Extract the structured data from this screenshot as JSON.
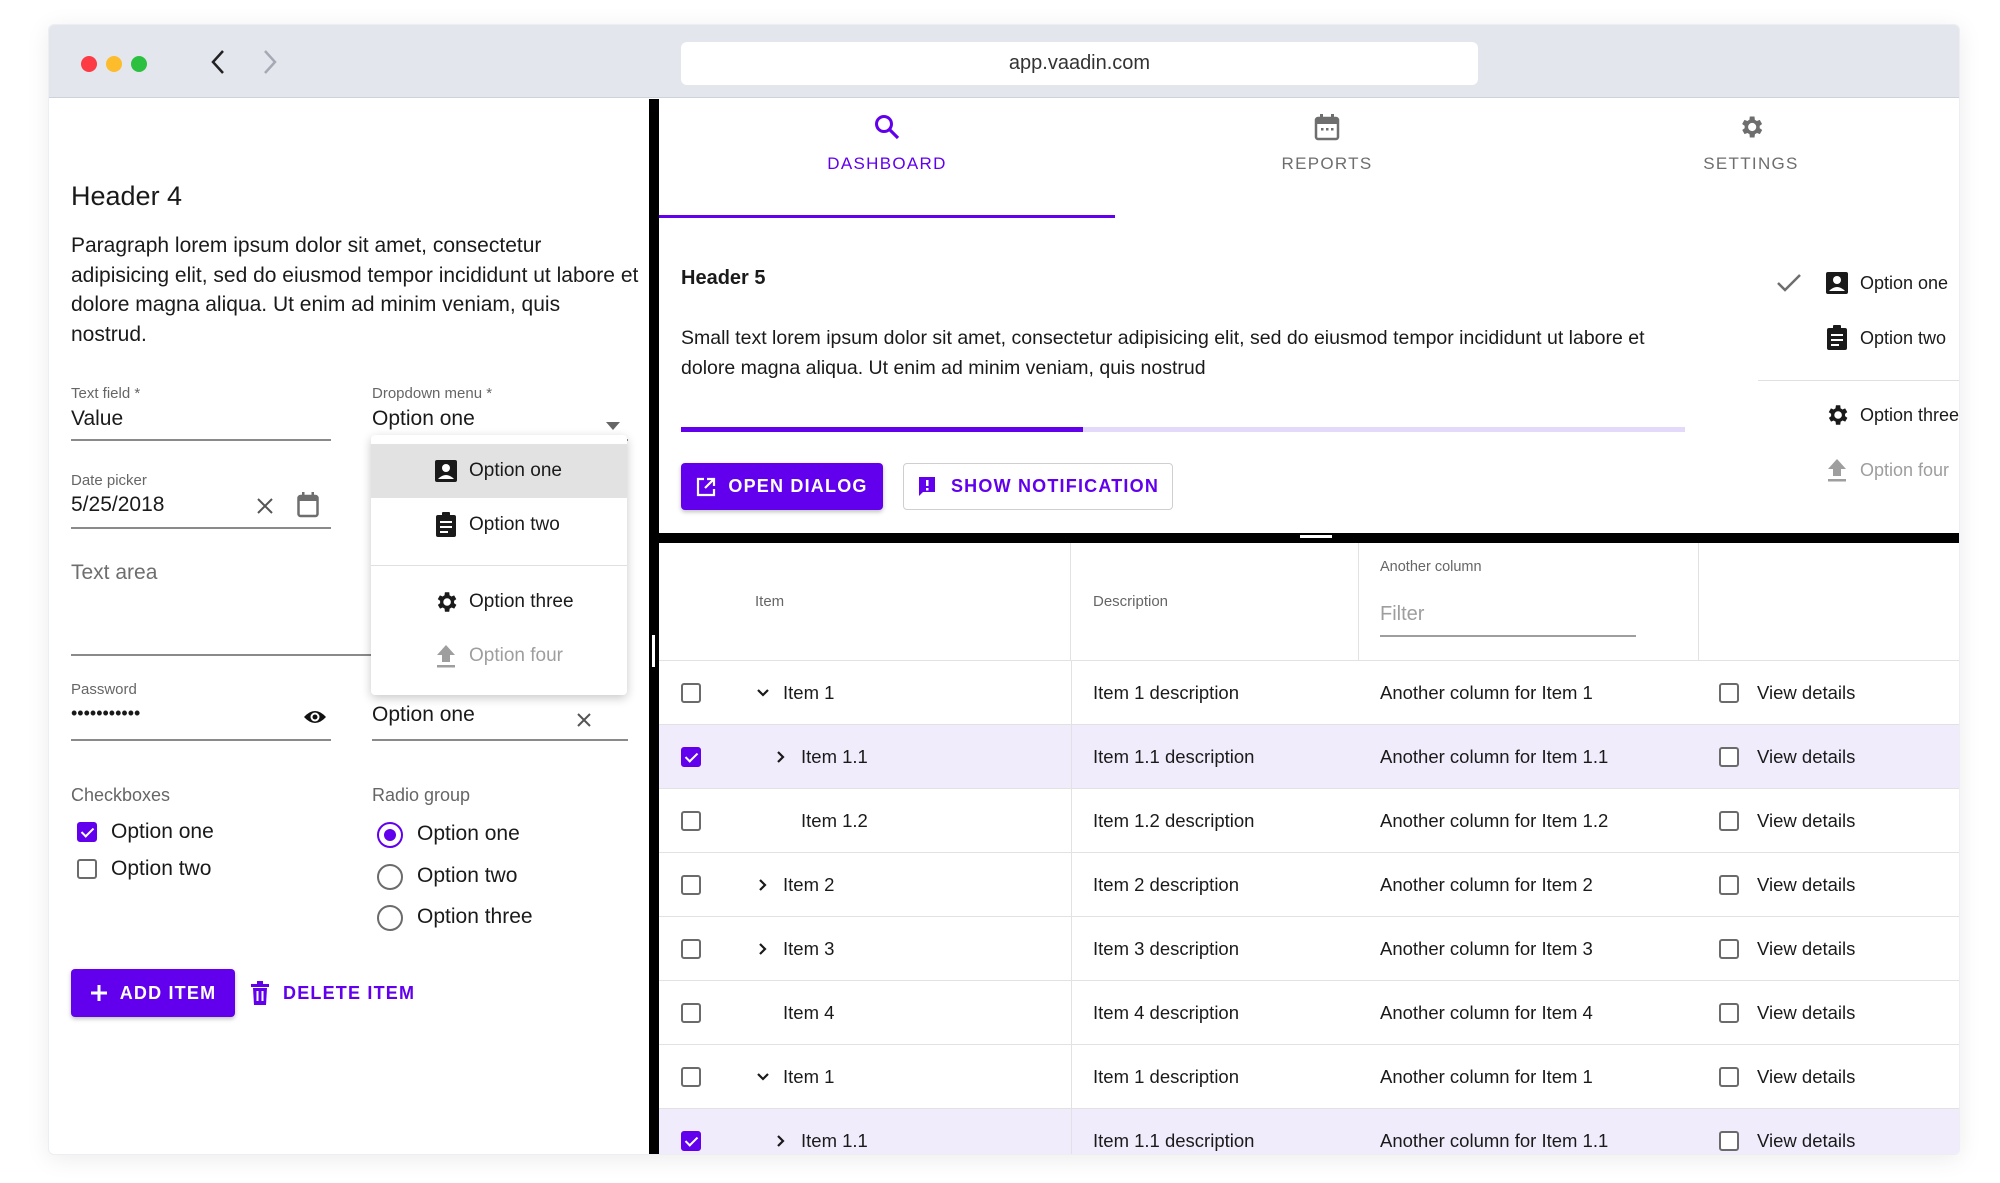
{
  "browser": {
    "url": "app.vaadin.com",
    "back_icon": "chevron-left-icon",
    "forward_icon": "chevron-right-icon"
  },
  "left": {
    "header": "Header 4",
    "paragraph": "Paragraph lorem ipsum dolor sit amet, consectetur adipisicing elit, sed do eiusmod tempor incididunt ut labore et dolore magna aliqua. Ut enim ad minim veniam, quis nostrud.",
    "text_field": {
      "label": "Text field *",
      "value": "Value"
    },
    "dropdown": {
      "label": "Dropdown menu *",
      "value": "Option one"
    },
    "date_picker": {
      "label": "Date picker",
      "value": "5/25/2018"
    },
    "text_area": {
      "placeholder": "Text area"
    },
    "password": {
      "label": "Password",
      "value": "•••••••••••"
    },
    "combo_box": {
      "value": "Option one"
    },
    "dropdown_menu": {
      "items": [
        {
          "label": "Option one",
          "icon": "account-box-icon",
          "highlighted": true,
          "disabled": false
        },
        {
          "label": "Option two",
          "icon": "clipboard-icon",
          "highlighted": false,
          "disabled": false
        },
        {
          "label": "Option three",
          "icon": "gear-icon",
          "highlighted": false,
          "disabled": false
        },
        {
          "label": "Option four",
          "icon": "upload-icon",
          "highlighted": false,
          "disabled": true
        }
      ]
    },
    "checkboxes": {
      "label": "Checkboxes",
      "items": [
        {
          "label": "Option one",
          "checked": true
        },
        {
          "label": "Option two",
          "checked": false
        }
      ]
    },
    "radio_group": {
      "label": "Radio group",
      "items": [
        {
          "label": "Option one",
          "checked": true
        },
        {
          "label": "Option two",
          "checked": false
        },
        {
          "label": "Option three",
          "checked": false
        }
      ]
    },
    "add_button": "ADD ITEM",
    "delete_button": "DELETE ITEM"
  },
  "right": {
    "tabs": [
      {
        "label": "DASHBOARD",
        "icon": "search-icon",
        "active": true
      },
      {
        "label": "REPORTS",
        "icon": "calendar-icon",
        "active": false
      },
      {
        "label": "SETTINGS",
        "icon": "gear-icon",
        "active": false
      }
    ],
    "header": "Header 5",
    "small_text": "Small text lorem ipsum dolor sit amet, consectetur adipisicing elit, sed do eiusmod tempor incididunt ut labore et dolore magna aliqua. Ut enim ad minim veniam, quis nostrud",
    "progress": 0.4,
    "open_dialog_button": "OPEN DIALOG",
    "show_notification_button": "SHOW NOTIFICATION",
    "side_menu": {
      "items": [
        {
          "label": "Option one",
          "icon": "account-box-icon",
          "checked": true,
          "disabled": false
        },
        {
          "label": "Option two",
          "icon": "clipboard-icon",
          "checked": false,
          "disabled": false
        },
        {
          "label": "Option three",
          "icon": "gear-icon",
          "checked": false,
          "disabled": false
        },
        {
          "label": "Option four",
          "icon": "upload-icon",
          "checked": false,
          "disabled": true
        }
      ]
    },
    "grid": {
      "columns": {
        "item": "Item",
        "description": "Description",
        "another": "Another column",
        "filter_placeholder": "Filter"
      },
      "rows": [
        {
          "selected": false,
          "toggle": "expanded",
          "level": 0,
          "item": "Item 1",
          "description": "Item 1 description",
          "another": "Another column for Item 1",
          "details": "View details",
          "details_checked": false
        },
        {
          "selected": true,
          "toggle": "collapsed",
          "level": 1,
          "item": "Item 1.1",
          "description": "Item 1.1 description",
          "another": "Another column for Item 1.1",
          "details": "View details",
          "details_checked": false
        },
        {
          "selected": false,
          "toggle": "none",
          "level": 1,
          "item": "Item 1.2",
          "description": "Item 1.2 description",
          "another": "Another column for Item 1.2",
          "details": "View details",
          "details_checked": false
        },
        {
          "selected": false,
          "toggle": "collapsed",
          "level": 0,
          "item": "Item 2",
          "description": "Item 2 description",
          "another": "Another column for Item 2",
          "details": "View details",
          "details_checked": false
        },
        {
          "selected": false,
          "toggle": "collapsed",
          "level": 0,
          "item": "Item 3",
          "description": "Item 3 description",
          "another": "Another column for Item 3",
          "details": "View details",
          "details_checked": false
        },
        {
          "selected": false,
          "toggle": "none",
          "level": 0,
          "item": "Item 4",
          "description": "Item 4 description",
          "another": "Another column for Item 4",
          "details": "View details",
          "details_checked": false
        },
        {
          "selected": false,
          "toggle": "expanded",
          "level": 0,
          "item": "Item 1",
          "description": "Item 1 description",
          "another": "Another column for Item 1",
          "details": "View details",
          "details_checked": false
        },
        {
          "selected": true,
          "toggle": "collapsed",
          "level": 1,
          "item": "Item 1.1",
          "description": "Item 1.1 description",
          "another": "Another column for Item 1.1",
          "details": "View details",
          "details_checked": false
        }
      ]
    }
  },
  "colors": {
    "accent": "#6200ee",
    "selected_row": "#f0ecfb",
    "progress_track": "#e3d9fb"
  }
}
